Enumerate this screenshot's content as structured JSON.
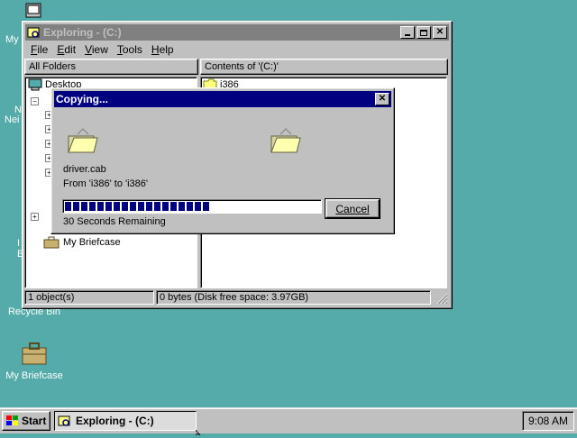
{
  "desktop": {
    "icons": [
      {
        "name": "Recycle Bin",
        "icon": "recycle-bin-icon"
      },
      {
        "name": "My Briefcase",
        "icon": "briefcase-icon"
      }
    ],
    "partial_labels": [
      "My",
      "N",
      "Nei",
      "I",
      "E"
    ]
  },
  "explorer": {
    "title": "Exploring - (C:)",
    "menu": [
      {
        "label": "File",
        "key": "F",
        "rest": "ile"
      },
      {
        "label": "Edit",
        "key": "E",
        "rest": "dit"
      },
      {
        "label": "View",
        "key": "V",
        "rest": "iew"
      },
      {
        "label": "Tools",
        "key": "T",
        "rest": "ools"
      },
      {
        "label": "Help",
        "key": "H",
        "rest": "elp"
      }
    ],
    "left_header": "All Folders",
    "right_header": "Contents of '(C:)'",
    "tree": {
      "desktop": "Desktop",
      "briefcase": "My Briefcase"
    },
    "contents": [
      {
        "name": "i386",
        "icon": "folder-icon"
      }
    ],
    "status_left": "1 object(s)",
    "status_right": "0 bytes (Disk free space: 3.97GB)"
  },
  "copy_dialog": {
    "title": "Copying...",
    "file": "driver.cab",
    "from_to": "From 'i386' to 'i386'",
    "progress": 0.58,
    "remaining": "30 Seconds Remaining",
    "cancel_label": "Cancel"
  },
  "taskbar": {
    "start_label": "Start",
    "task_label": "Exploring - (C:)",
    "clock": "9:08 AM"
  },
  "colors": {
    "desktop": "#55aaaa",
    "active_title": "#000080",
    "inactive_title": "#808080",
    "progress": "#000080"
  }
}
